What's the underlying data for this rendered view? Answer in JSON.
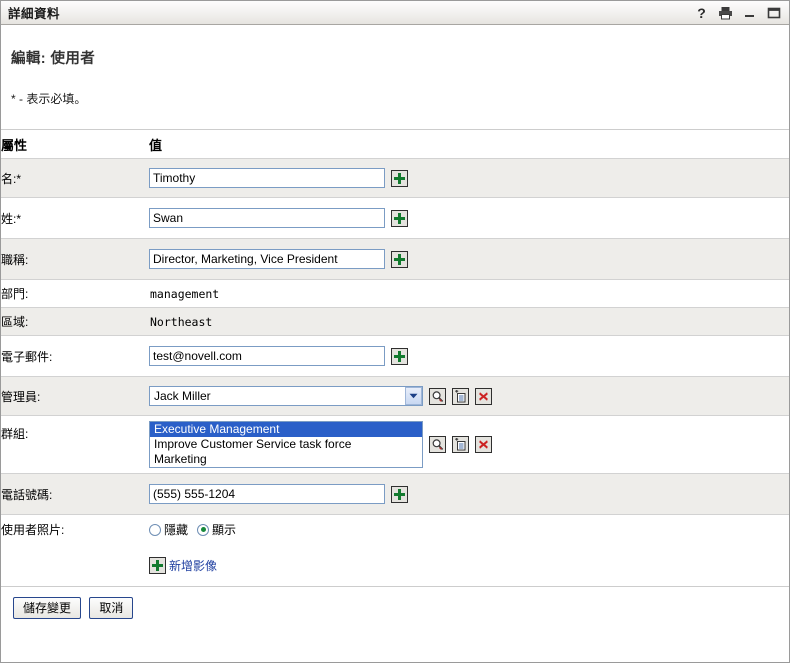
{
  "window": {
    "title": "詳細資料",
    "buttons": [
      {
        "name": "help-icon",
        "label": "?"
      },
      {
        "name": "print-icon",
        "label": "列印"
      },
      {
        "name": "minimize-icon",
        "label": "最小化"
      },
      {
        "name": "maximize-icon",
        "label": "最大化"
      }
    ]
  },
  "page": {
    "heading": "編輯: 使用者",
    "required_note": "* - 表示必填。"
  },
  "table": {
    "headers": {
      "attribute": "屬性",
      "value": "值"
    },
    "rows": [
      {
        "label": "名:*",
        "type": "text",
        "value": "Timothy"
      },
      {
        "label": "姓:*",
        "type": "text",
        "value": "Swan"
      },
      {
        "label": "職稱:",
        "type": "text",
        "value": "Director, Marketing, Vice President"
      },
      {
        "label": "部門:",
        "type": "static",
        "value": "management"
      },
      {
        "label": "區域:",
        "type": "static",
        "value": "Northeast"
      },
      {
        "label": "電子郵件:",
        "type": "text",
        "value": "test@novell.com"
      },
      {
        "label": "管理員:",
        "type": "combo",
        "value": "Jack Miller"
      },
      {
        "label": "群組:",
        "type": "list",
        "options": [
          "Executive Management",
          "Improve Customer Service task force",
          "Marketing"
        ],
        "selected_index": 0
      },
      {
        "label": "電話號碼:",
        "type": "text",
        "value": "(555) 555-1204"
      },
      {
        "label": "使用者照片:",
        "type": "radio",
        "options": [
          {
            "label": "隱藏",
            "selected": false
          },
          {
            "label": "顯示",
            "selected": true
          }
        ]
      }
    ],
    "add_image_link": "新增影像"
  },
  "icons": {
    "plus": "plus-icon",
    "lookup": "magnifier-icon",
    "history": "document-add-icon",
    "clear": "red-x-icon",
    "dropdown": "chevron-down-icon"
  },
  "footer": {
    "save_label": "儲存變更",
    "cancel_label": "取消"
  },
  "colors": {
    "accent_link": "#1f3fa0",
    "selection": "#2a5fc8",
    "plus_green": "#127a2e",
    "clear_red": "#cc2222",
    "row_alt": "#eeedea",
    "field_border": "#7b9cc4"
  }
}
